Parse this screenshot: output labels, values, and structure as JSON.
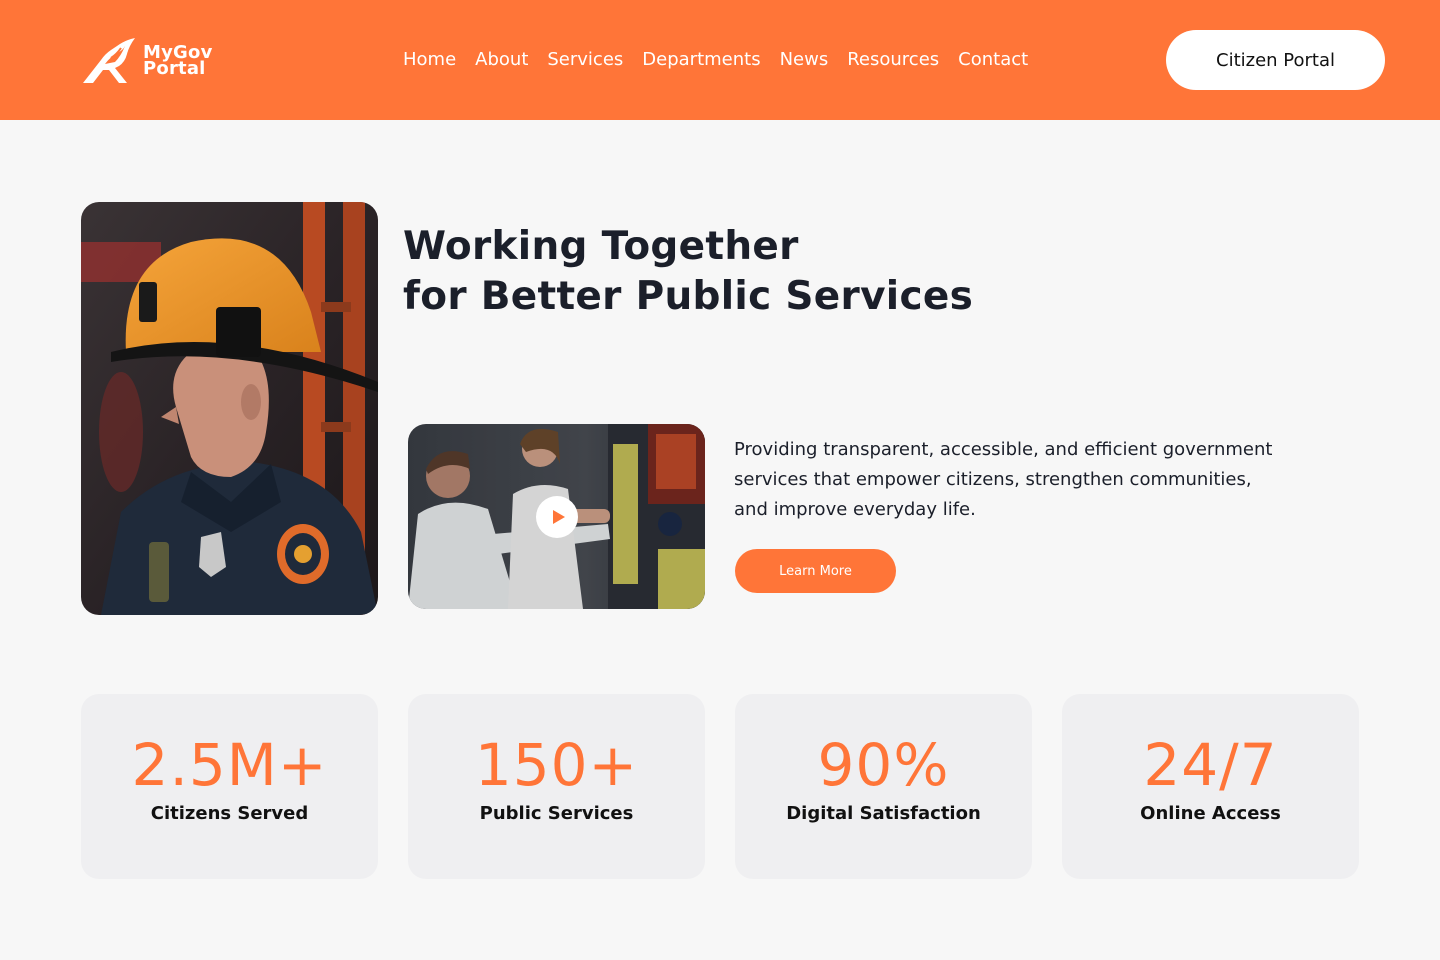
{
  "brand": {
    "name_line1": "MyGov",
    "name_line2": "Portal",
    "logo_icon": "stylized-bird-r-mark"
  },
  "nav": {
    "items": [
      {
        "label": "Home"
      },
      {
        "label": "About"
      },
      {
        "label": "Services"
      },
      {
        "label": "Departments"
      },
      {
        "label": "News"
      },
      {
        "label": "Resources"
      },
      {
        "label": "Contact"
      }
    ],
    "portal_button": "Citizen Portal"
  },
  "hero": {
    "title_line1": "Working Together",
    "title_line2": "for Better Public Services",
    "description_lines": [
      "Providing transparent, accessible, and efficient government",
      "services that empower citizens, strengthen communities,",
      "and improve everyday life."
    ],
    "cta_label": "Learn More",
    "photo": "firefighter-portrait",
    "video_thumbnail": "paramedics-ambulance",
    "play_icon": "play-icon"
  },
  "stats": [
    {
      "value": "2.5M+",
      "label": "Citizens Served"
    },
    {
      "value": "150+",
      "label": "Public Services"
    },
    {
      "value": "90%",
      "label": "Digital Satisfaction"
    },
    {
      "value": "24/7",
      "label": "Online Access"
    }
  ],
  "colors": {
    "accent": "#ff7538",
    "background": "#f7f7f7",
    "card": "#efeff1",
    "text": "#1b1f2a"
  }
}
